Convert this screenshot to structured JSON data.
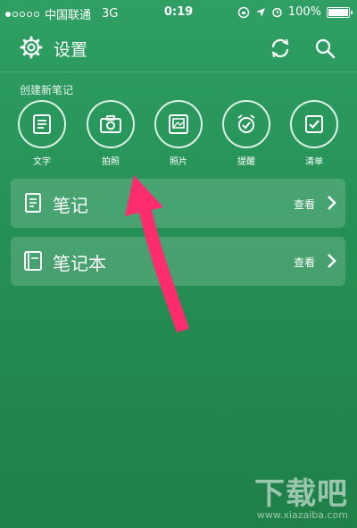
{
  "status_bar": {
    "carrier": "中国联通",
    "network": "3G",
    "time": "0:19",
    "battery": "100%",
    "battery_level": 1.0
  },
  "header": {
    "title": "设置",
    "icons": [
      "gear-icon",
      "sync-icon",
      "search-icon"
    ]
  },
  "create_section": {
    "title": "创建新笔记",
    "buttons": [
      {
        "label": "文字",
        "icon": "text-note-icon"
      },
      {
        "label": "拍照",
        "icon": "camera-icon"
      },
      {
        "label": "照片",
        "icon": "photo-icon"
      },
      {
        "label": "提醒",
        "icon": "alarm-icon"
      },
      {
        "label": "清单",
        "icon": "checklist-icon"
      }
    ]
  },
  "cards": [
    {
      "label": "笔记",
      "action": "查看",
      "icon": "note-icon"
    },
    {
      "label": "笔记本",
      "action": "查看",
      "icon": "notebook-icon"
    }
  ],
  "annotation": {
    "color": "#ff2d6e",
    "icon": "red-arrow-pointing-to-camera"
  },
  "watermark": {
    "main": "下载吧",
    "sub": "www.xiazaiba.com"
  },
  "colors": {
    "background": "#259055"
  }
}
